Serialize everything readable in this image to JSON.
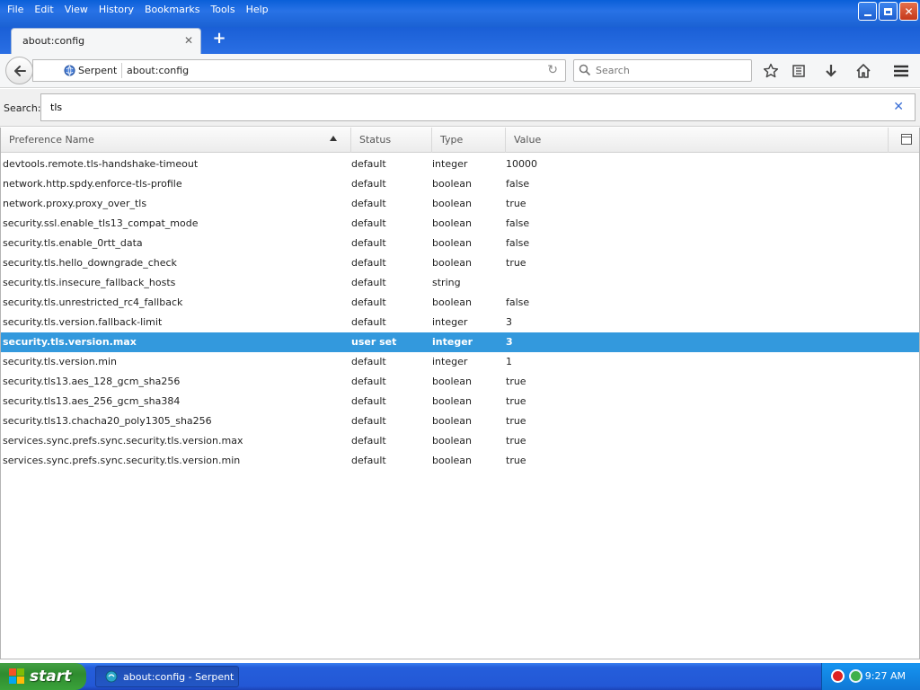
{
  "menu": [
    "File",
    "Edit",
    "View",
    "History",
    "Bookmarks",
    "Tools",
    "Help"
  ],
  "menu_accel": [
    "F",
    "E",
    "V",
    "H",
    "B",
    "T",
    "H"
  ],
  "tab": {
    "label": "about:config"
  },
  "nav": {
    "identity_label": "Serpent",
    "url": "about:config",
    "search_placeholder": "Search"
  },
  "config_search": {
    "label": "Search:",
    "value": "tls"
  },
  "columns": [
    "Preference Name",
    "Status",
    "Type",
    "Value"
  ],
  "rows": [
    {
      "name": "devtools.remote.tls-handshake-timeout",
      "status": "default",
      "type": "integer",
      "value": "10000"
    },
    {
      "name": "network.http.spdy.enforce-tls-profile",
      "status": "default",
      "type": "boolean",
      "value": "false"
    },
    {
      "name": "network.proxy.proxy_over_tls",
      "status": "default",
      "type": "boolean",
      "value": "true"
    },
    {
      "name": "security.ssl.enable_tls13_compat_mode",
      "status": "default",
      "type": "boolean",
      "value": "false"
    },
    {
      "name": "security.tls.enable_0rtt_data",
      "status": "default",
      "type": "boolean",
      "value": "false"
    },
    {
      "name": "security.tls.hello_downgrade_check",
      "status": "default",
      "type": "boolean",
      "value": "true"
    },
    {
      "name": "security.tls.insecure_fallback_hosts",
      "status": "default",
      "type": "string",
      "value": ""
    },
    {
      "name": "security.tls.unrestricted_rc4_fallback",
      "status": "default",
      "type": "boolean",
      "value": "false"
    },
    {
      "name": "security.tls.version.fallback-limit",
      "status": "default",
      "type": "integer",
      "value": "3"
    },
    {
      "name": "security.tls.version.max",
      "status": "user set",
      "type": "integer",
      "value": "3",
      "selected": true
    },
    {
      "name": "security.tls.version.min",
      "status": "default",
      "type": "integer",
      "value": "1"
    },
    {
      "name": "security.tls13.aes_128_gcm_sha256",
      "status": "default",
      "type": "boolean",
      "value": "true"
    },
    {
      "name": "security.tls13.aes_256_gcm_sha384",
      "status": "default",
      "type": "boolean",
      "value": "true"
    },
    {
      "name": "security.tls13.chacha20_poly1305_sha256",
      "status": "default",
      "type": "boolean",
      "value": "true"
    },
    {
      "name": "services.sync.prefs.sync.security.tls.version.max",
      "status": "default",
      "type": "boolean",
      "value": "true"
    },
    {
      "name": "services.sync.prefs.sync.security.tls.version.min",
      "status": "default",
      "type": "boolean",
      "value": "true"
    }
  ],
  "taskbar": {
    "start_label": "start",
    "task_label": "about:config - Serpent",
    "clock": "9:27 AM"
  },
  "colors": {
    "selection": "#3399dd",
    "titlebar": "#1b62d4",
    "start_green": "#3aa23a"
  }
}
